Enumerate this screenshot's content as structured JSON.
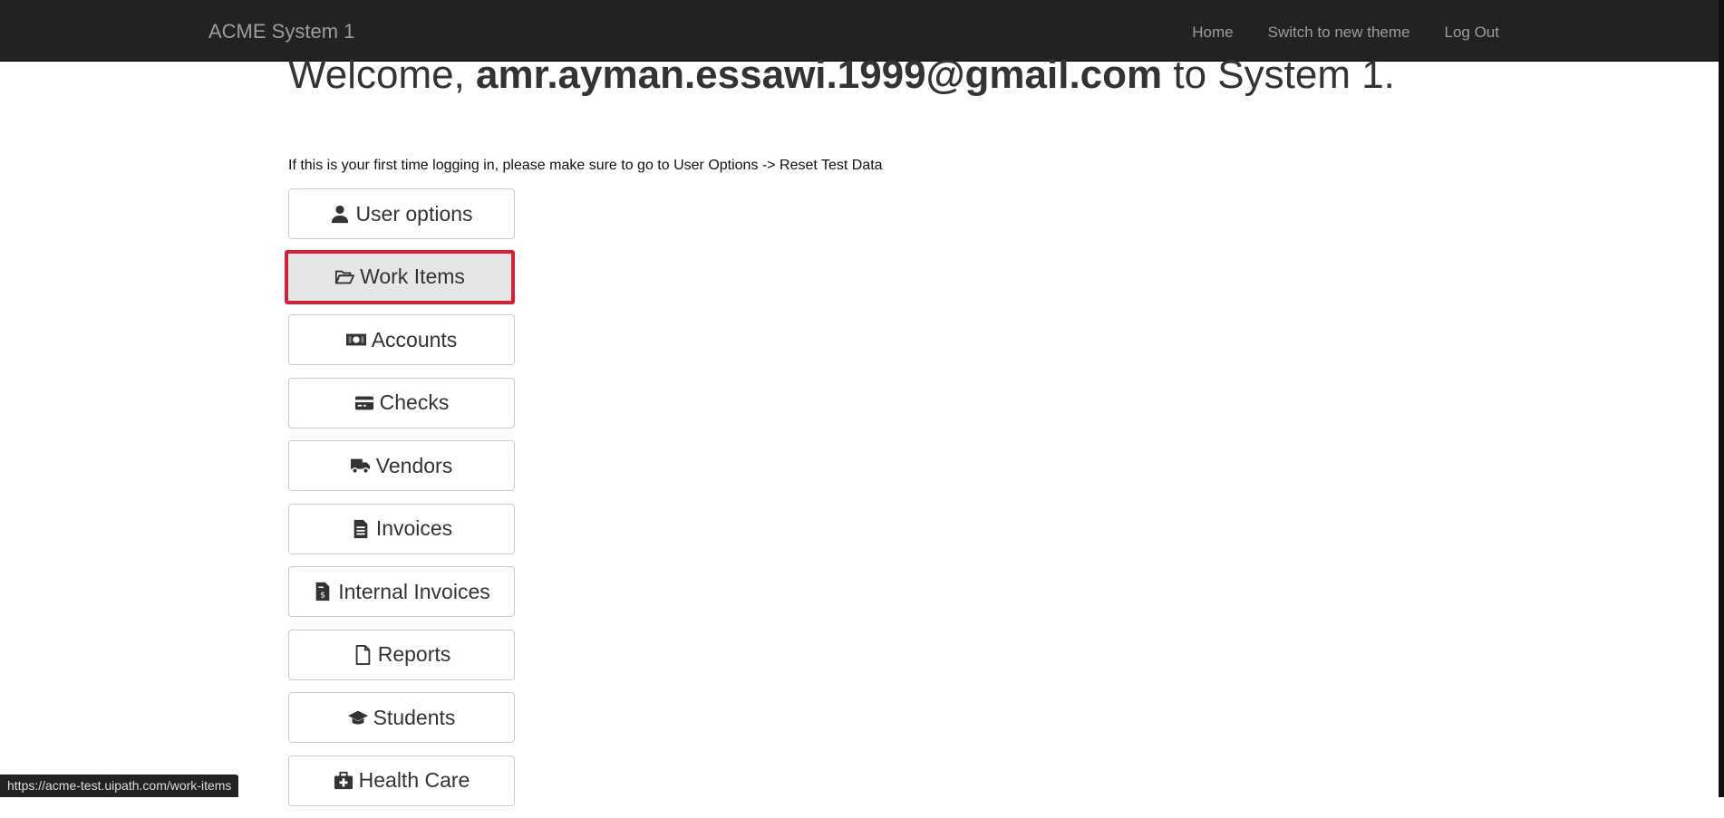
{
  "navbar": {
    "brand": "ACME System 1",
    "links": [
      "Home",
      "Switch to new theme",
      "Log Out"
    ]
  },
  "welcome": {
    "prefix": "Welcome, ",
    "email": "amr.ayman.essawi.1999@gmail.com",
    "suffix": " to System 1."
  },
  "hint": "If this is your first time logging in, please make sure to go to User Options -> Reset Test Data",
  "menu": [
    {
      "label": "User options",
      "icon": "user-icon"
    },
    {
      "label": "Work Items",
      "icon": "folder-open-icon",
      "highlighted": true
    },
    {
      "label": "Accounts",
      "icon": "money-icon"
    },
    {
      "label": "Checks",
      "icon": "credit-card-icon"
    },
    {
      "label": "Vendors",
      "icon": "truck-icon"
    },
    {
      "label": "Invoices",
      "icon": "file-text-icon"
    },
    {
      "label": "Internal Invoices",
      "icon": "file-invoice-dollar-icon"
    },
    {
      "label": "Reports",
      "icon": "file-icon"
    },
    {
      "label": "Students",
      "icon": "graduation-cap-icon"
    },
    {
      "label": "Health Care",
      "icon": "medkit-icon"
    }
  ],
  "status_url": "https://acme-test.uipath.com/work-items",
  "colors": {
    "navbar_bg": "#222222",
    "highlight_border": "#d0233a"
  }
}
